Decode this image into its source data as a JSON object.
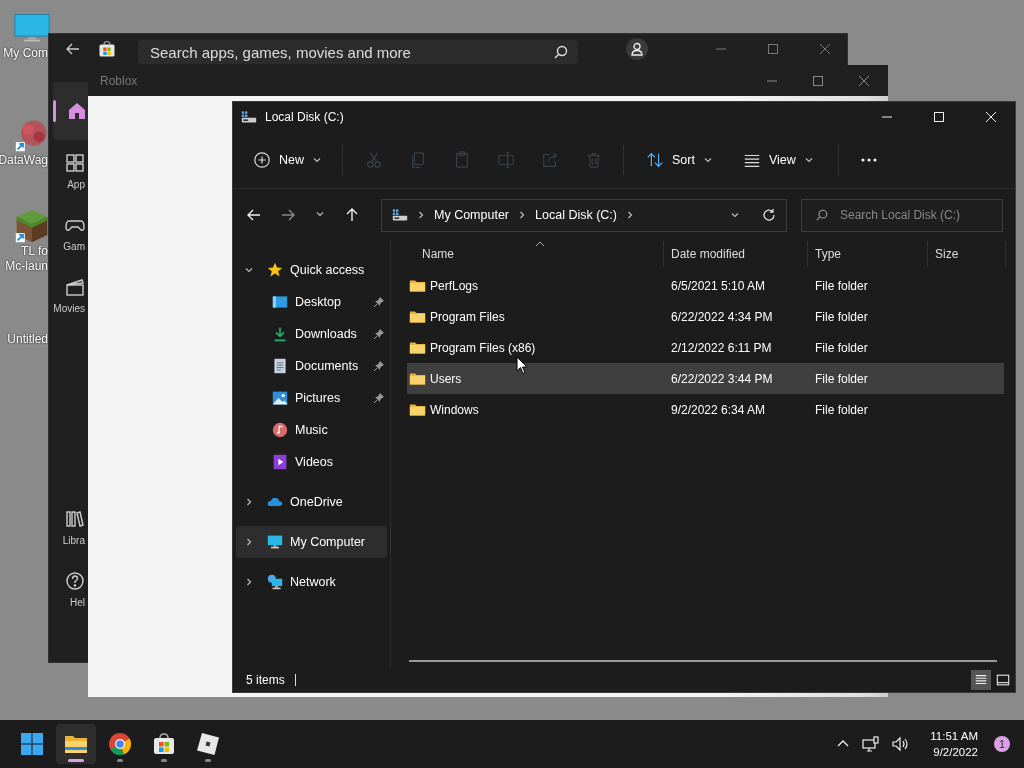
{
  "desktop_icons": [
    {
      "kind": "monitor",
      "lines": [
        "My Com"
      ]
    },
    {
      "kind": "shortcut-blob",
      "lines": [
        "DataWag"
      ]
    },
    {
      "kind": "shortcut-block",
      "lines": [
        "TL fo",
        "Mc-laun"
      ]
    },
    {
      "kind": "file",
      "lines": [
        "Untitled"
      ]
    }
  ],
  "store_window": {
    "search": {
      "placeholder": "Search apps, games, movies and more"
    },
    "nav": [
      {
        "kind": "home",
        "selected": true
      },
      {
        "kind": "apps",
        "label": "App",
        "selected": false
      },
      {
        "kind": "gaming",
        "label": "Gam",
        "selected": false
      },
      {
        "kind": "movies",
        "label": "Movies",
        "selected": false
      },
      {
        "kind": "library",
        "label": "Libra",
        "selected": false
      },
      {
        "kind": "help",
        "label": "Hel",
        "selected": false
      }
    ]
  },
  "roblox_window": {
    "title": "Roblox"
  },
  "explorer": {
    "title": "Local Disk (C:)",
    "toolbar": [
      {
        "kind": "new",
        "label": "New",
        "disabled": false
      },
      {
        "kind": "cut",
        "disabled": true
      },
      {
        "kind": "copy",
        "disabled": true
      },
      {
        "kind": "paste",
        "disabled": true
      },
      {
        "kind": "rename",
        "disabled": true
      },
      {
        "kind": "share",
        "disabled": true
      },
      {
        "kind": "delete",
        "disabled": true
      },
      {
        "kind": "sort",
        "label": "Sort",
        "disabled": false
      },
      {
        "kind": "view",
        "label": "View",
        "disabled": false
      },
      {
        "kind": "more",
        "disabled": false
      }
    ],
    "navigation": {
      "back_disabled": false,
      "forward_disabled": true
    },
    "address": {
      "crumbs": [
        "My Computer",
        "Local Disk (C:)"
      ]
    },
    "search": {
      "placeholder": "Search Local Disk (C:)"
    },
    "sidebar": [
      {
        "kind": "star",
        "label": "Quick access",
        "expanded": true,
        "selected": false,
        "children": [
          {
            "kind": "desktop",
            "label": "Desktop",
            "pinned": true,
            "selected": false
          },
          {
            "kind": "download",
            "label": "Downloads",
            "pinned": true,
            "selected": false
          },
          {
            "kind": "documents",
            "label": "Documents",
            "pinned": true,
            "selected": false
          },
          {
            "kind": "pictures",
            "label": "Pictures",
            "pinned": true,
            "selected": false
          },
          {
            "kind": "music",
            "label": "Music",
            "pinned": false,
            "selected": false
          },
          {
            "kind": "videos",
            "label": "Videos",
            "pinned": false,
            "selected": false
          }
        ]
      },
      {
        "kind": "cloud",
        "label": "OneDrive",
        "expanded": false,
        "selected": false
      },
      {
        "kind": "computer",
        "label": "My Computer",
        "expanded": false,
        "selected": true
      },
      {
        "kind": "network",
        "label": "Network",
        "expanded": false,
        "selected": false
      }
    ],
    "columns": [
      "Name",
      "Date modified",
      "Type",
      "Size"
    ],
    "rows": [
      {
        "name": "PerfLogs",
        "date": "6/5/2021 5:10 AM",
        "type": "File folder",
        "selected": false
      },
      {
        "name": "Program Files",
        "date": "6/22/2022 4:34 PM",
        "type": "File folder",
        "selected": false
      },
      {
        "name": "Program Files (x86)",
        "date": "2/12/2022 6:11 PM",
        "type": "File folder",
        "selected": false
      },
      {
        "name": "Users",
        "date": "6/22/2022 3:44 PM",
        "type": "File folder",
        "selected": true
      },
      {
        "name": "Windows",
        "date": "9/2/2022 6:34 AM",
        "type": "File folder",
        "selected": false
      }
    ],
    "status": "5 items",
    "views": [
      {
        "kind": "details",
        "selected": true
      },
      {
        "kind": "tiles",
        "selected": false
      }
    ]
  },
  "taskbar": {
    "apps": [
      {
        "kind": "start",
        "active": false,
        "running": false
      },
      {
        "kind": "explorer",
        "active": true,
        "running": true
      },
      {
        "kind": "chrome",
        "active": false,
        "running": true
      },
      {
        "kind": "store",
        "active": false,
        "running": true
      },
      {
        "kind": "roblox",
        "active": false,
        "running": true
      }
    ],
    "time": "11:51 AM",
    "date": "9/2/2022",
    "notifications": "1"
  }
}
